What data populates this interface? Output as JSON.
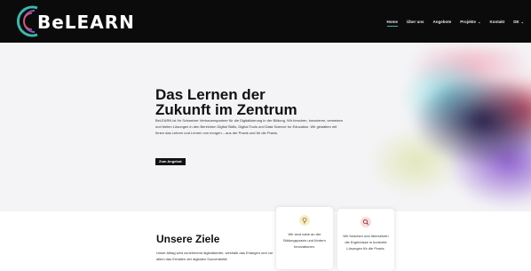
{
  "header": {
    "logo_text": "BeLEARN",
    "nav": [
      {
        "label": "Home",
        "active": true
      },
      {
        "label": "Über uns"
      },
      {
        "label": "Angebote"
      },
      {
        "label": "Projekte"
      },
      {
        "label": "Kontakt"
      },
      {
        "label": "DE"
      }
    ]
  },
  "hero": {
    "title_line1": "Das Lernen der",
    "title_line2": "Zukunft im Zentrum",
    "text": "BeLEARN ist Ihr Schweizer Vertrauenspartner für die Digitalisierung in der Bildung. Wir forschen, innovieren, vernetzen und bieten Lösungen in den Bereichen Digital Skills, Digital Tools und Data Science for Education. Wir gestalten mit Ihnen das Lehren und Lernen von morgen – aus der Praxis und für die Praxis.",
    "button_label": "Zum Angebot"
  },
  "goals": {
    "title": "Unsere Ziele",
    "text": "Unser Alltag wird zunehmend digitalisierter, weshalb das Erlangen und vor allem das Erhalten der digitalen Souveränität",
    "cards": [
      {
        "icon": "lightbulb-icon",
        "text": "Wir sind nahe an der Bildungspraxis und fördern Innovationen."
      },
      {
        "icon": "magnifier-icon",
        "text": "Wir forschen und übersetzen die Ergebnisse in konkrete Lösungen für die Praxis."
      }
    ]
  },
  "colors": {
    "header_bg": "#0b0b0b",
    "accent": "#3fb6a8",
    "card1_icon_bg": "#f6eec6",
    "card2_icon_bg": "#f9d9d9",
    "icon_stroke": "#8a5a2a"
  }
}
